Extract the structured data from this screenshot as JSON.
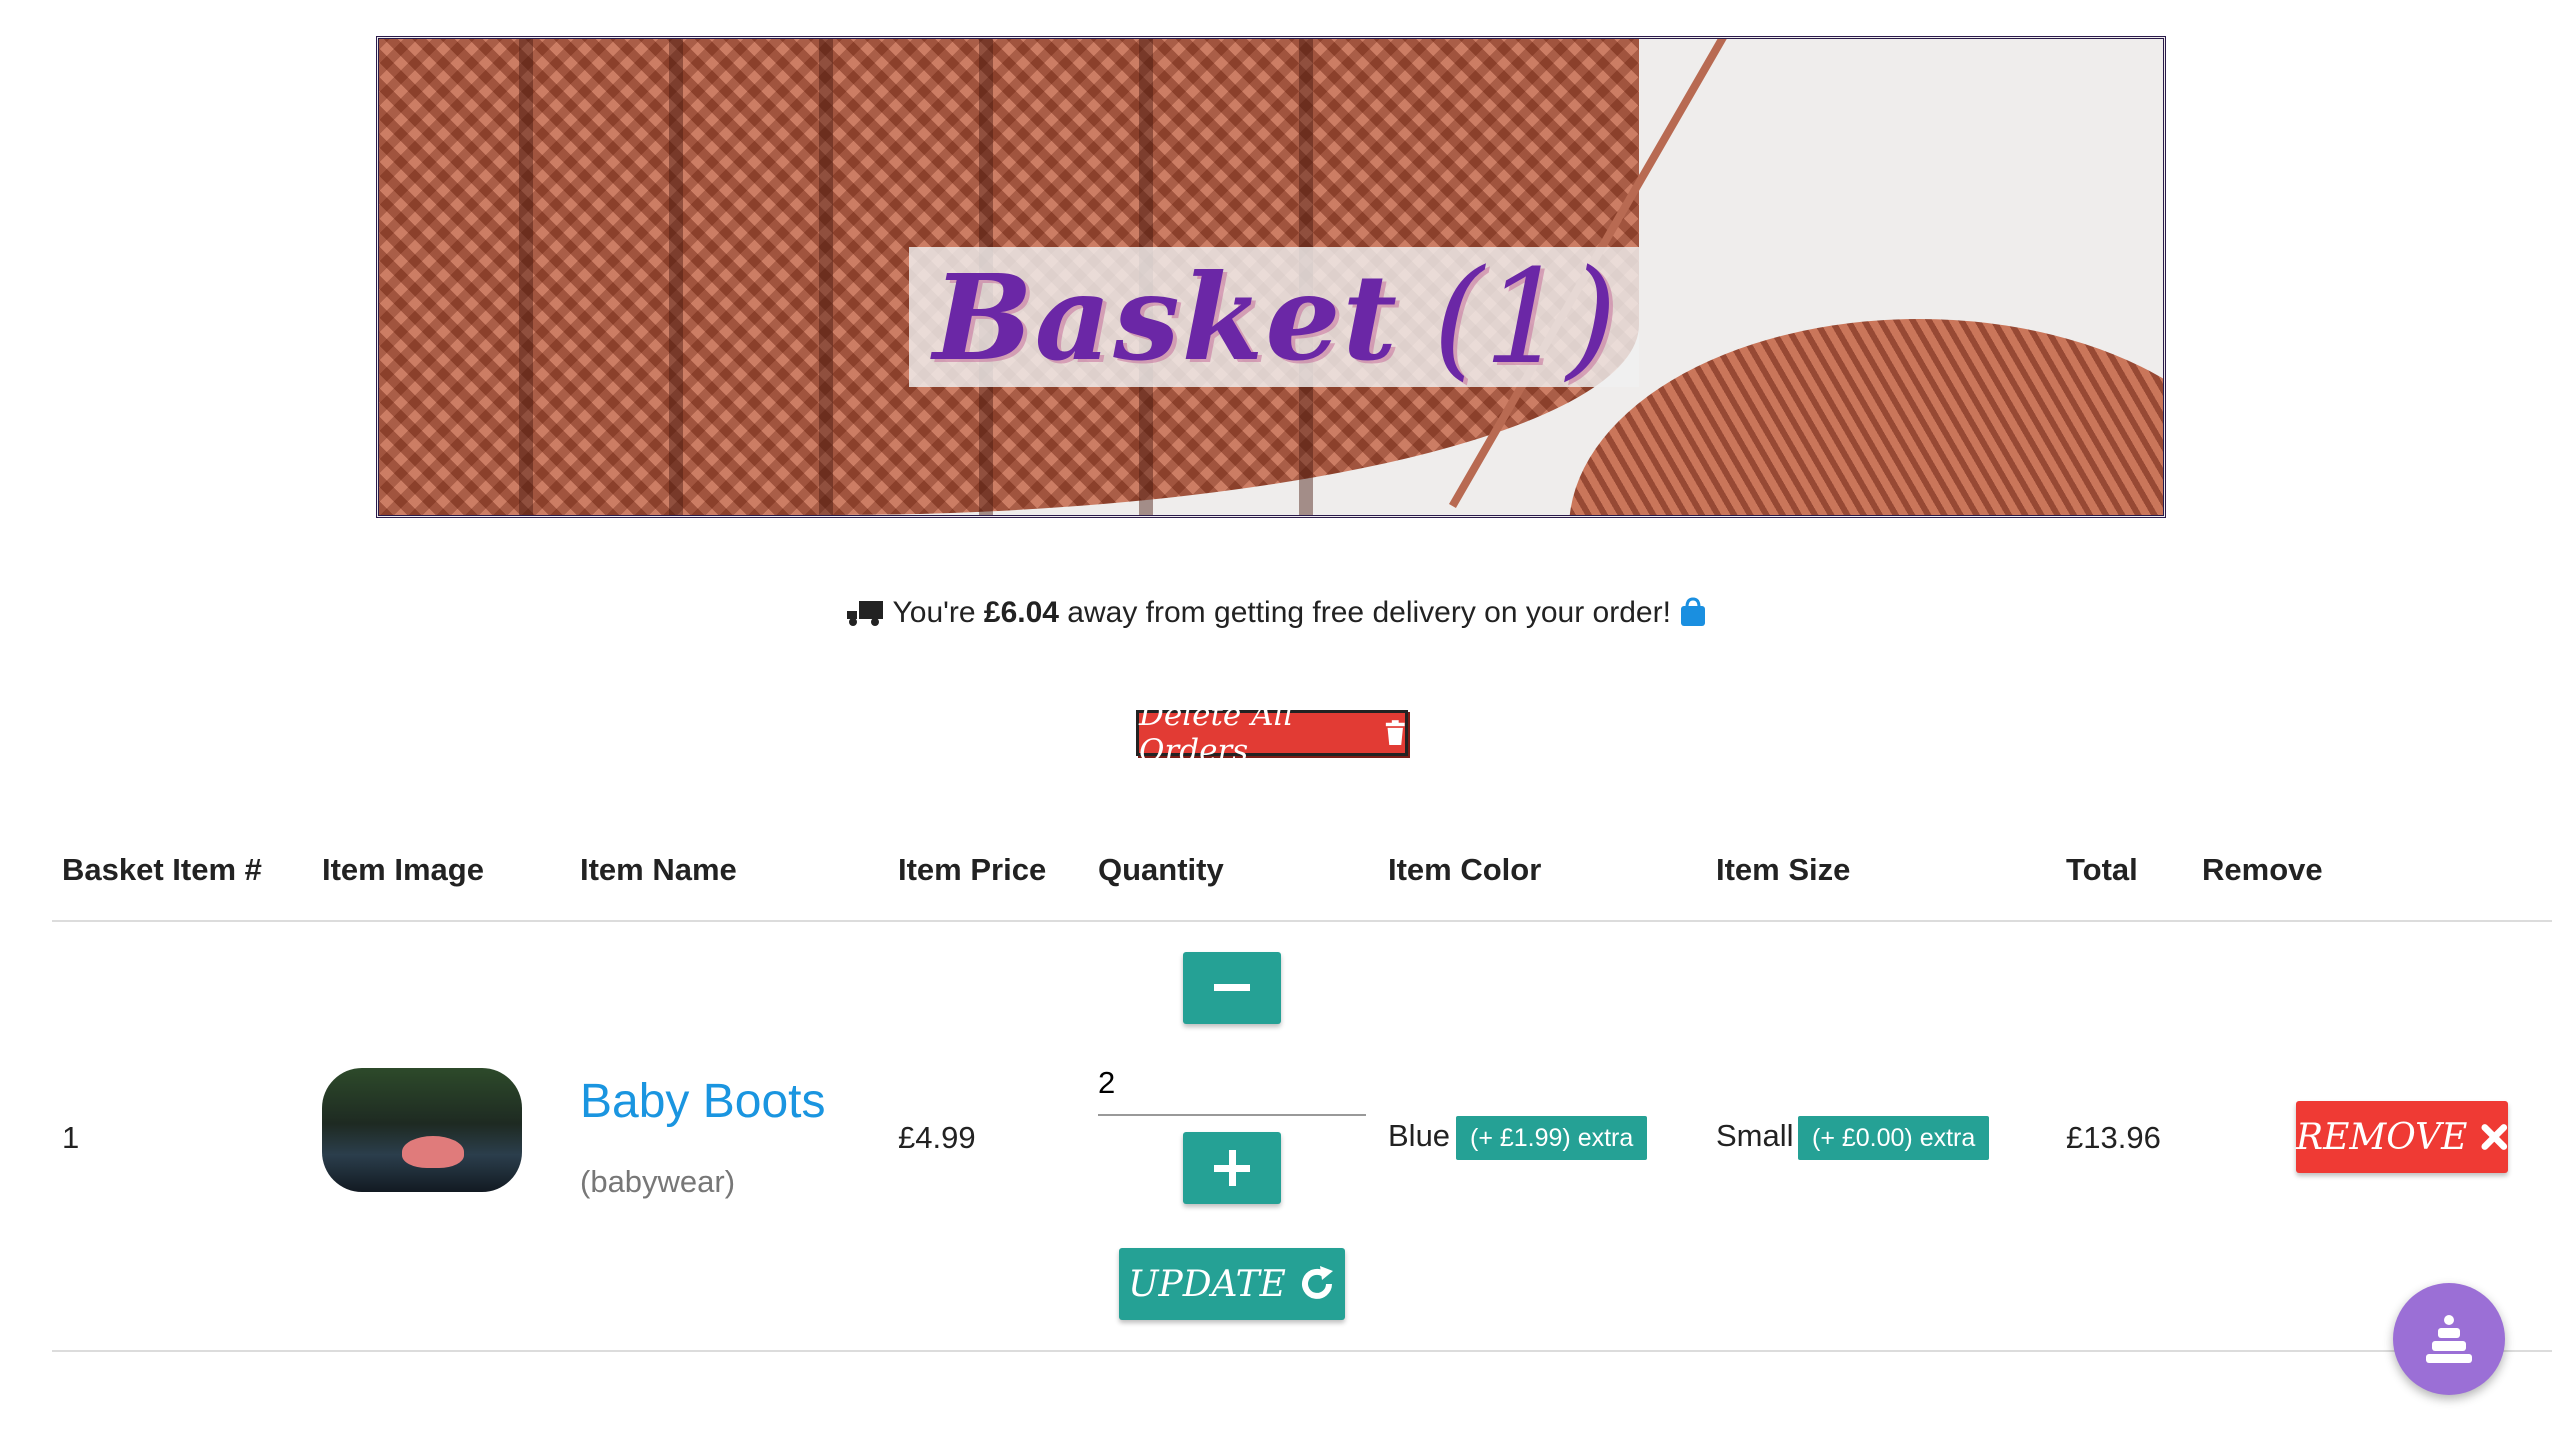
{
  "banner": {
    "title": "Basket",
    "count": "(1)",
    "icon": "shopping-basket-icon",
    "title_color": "#6b27a6"
  },
  "delivery": {
    "prefix": "You're ",
    "amount": "£6.04",
    "suffix": " away from getting free delivery on your order!",
    "left_icon": "shipping-truck-icon",
    "right_icon": "shopping-bag-icon"
  },
  "delete_all": {
    "label": "Delete All Orders",
    "icon": "trash-icon",
    "color": "#e23b34"
  },
  "table": {
    "headers": [
      "Basket Item #",
      "Item Image",
      "Item Name",
      "Item Price",
      "Quantity",
      "Item Color",
      "Item Size",
      "Total",
      "Remove"
    ],
    "rows": [
      {
        "number": "1",
        "name": "Baby Boots",
        "category": "(babywear)",
        "price": "£4.99",
        "quantity": "2",
        "color": "Blue",
        "color_extra": "(+ £1.99) extra",
        "size": "Small",
        "size_extra": "(+ £0.00) extra",
        "total": "£13.96"
      }
    ]
  },
  "buttons": {
    "update_label": "UPDATE",
    "remove_label": "REMOVE",
    "accent": "#25a195",
    "danger": "#ef3a34"
  },
  "fab": {
    "icon": "cake-icon",
    "color": "#9b6fd6"
  }
}
